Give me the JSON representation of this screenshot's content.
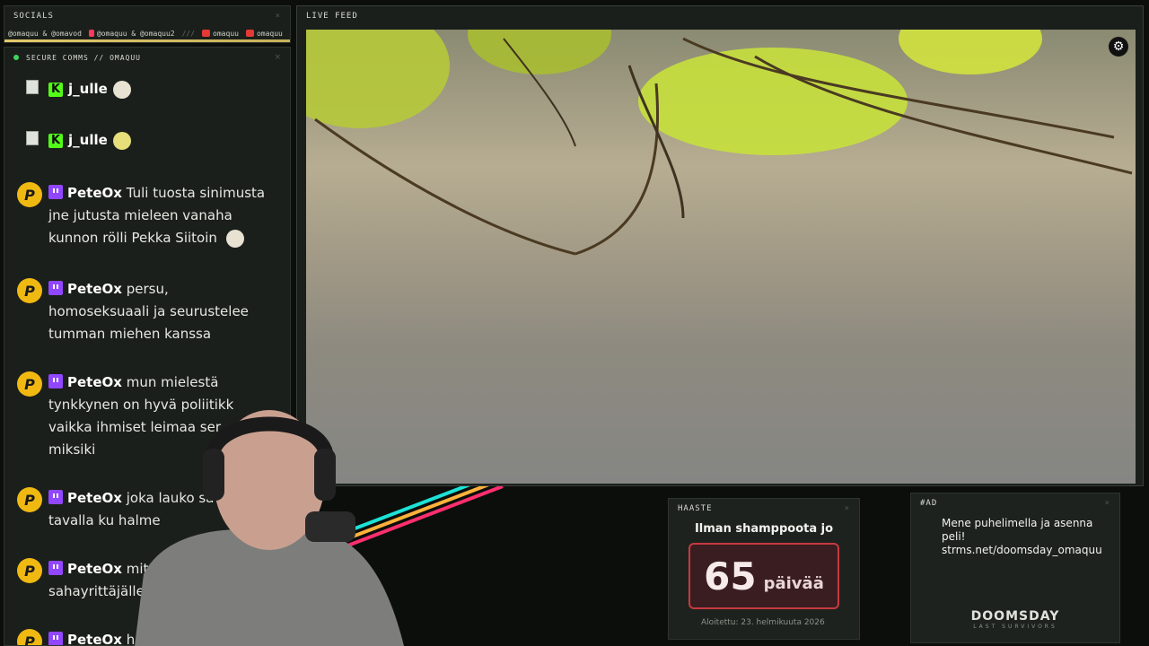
{
  "socials": {
    "title": "SOCIALS",
    "close": "×",
    "items": [
      {
        "text": "@omaquu & @omavod",
        "icon": "twitter-icon",
        "color": "#888888"
      },
      {
        "text": "@omaquu & @omaquu2",
        "icon": "tiktok-icon",
        "color": "#ff3b5c"
      },
      {
        "text": "///",
        "icon": "",
        "color": "#666666"
      },
      {
        "text": "omaquu",
        "icon": "kick-icon",
        "color": "#e53935"
      },
      {
        "text": "omaquu",
        "icon": "youtube-icon",
        "color": "#e53935"
      }
    ]
  },
  "chat": {
    "title": "SECURE COMMS // OMAQUU",
    "close": "×",
    "messages": [
      {
        "user": "j_ulle",
        "platform": "kick",
        "lines": [
          ""
        ]
      },
      {
        "user": "j_ulle",
        "platform": "kick",
        "lines": [
          ""
        ]
      },
      {
        "user": "PeteOx",
        "platform": "twitch",
        "lines": [
          "Tuli tuosta sinimusta",
          "jne jutusta mieleen vanaha",
          "kunnon rölli Pekka Siitoin"
        ]
      },
      {
        "user": "PeteOx",
        "platform": "twitch",
        "lines": [
          "persu,",
          "homoseksuaali ja seurustelee",
          "tumman miehen kanssa"
        ]
      },
      {
        "user": "PeteOx",
        "platform": "twitch",
        "lines": [
          "mun mielestä",
          "tynkkynen on hyvä poliitikk",
          "vaikka ihmiset leimaa ser",
          "miksiki"
        ]
      },
      {
        "user": "PeteOx",
        "platform": "twitch",
        "lines": [
          "joka lauko sa",
          "tavalla ku halme"
        ]
      },
      {
        "user": "PeteOx",
        "platform": "twitch",
        "lines": [
          "mit",
          "sahayrittäjälle"
        ]
      },
      {
        "user": "PeteOx",
        "platform": "twitch",
        "lines": [
          "h"
        ]
      }
    ]
  },
  "live_feed": {
    "title": "LIVE FEED",
    "settings_icon": "gear-icon"
  },
  "challenge": {
    "title": "HAASTE",
    "close": "×",
    "subtitle": "Ilman shamppoota jo",
    "count": "65",
    "unit": "päivää",
    "started": "Aloitettu: 23. helmikuuta 2026"
  },
  "ad": {
    "title": "#AD",
    "close": "×",
    "line1": "Mene puhelimella ja asenna peli!",
    "line2": "strms.net/doomsday_omaquu",
    "logo": "DOOMSDAY",
    "logo_sub": "LAST SURVIVORS"
  }
}
